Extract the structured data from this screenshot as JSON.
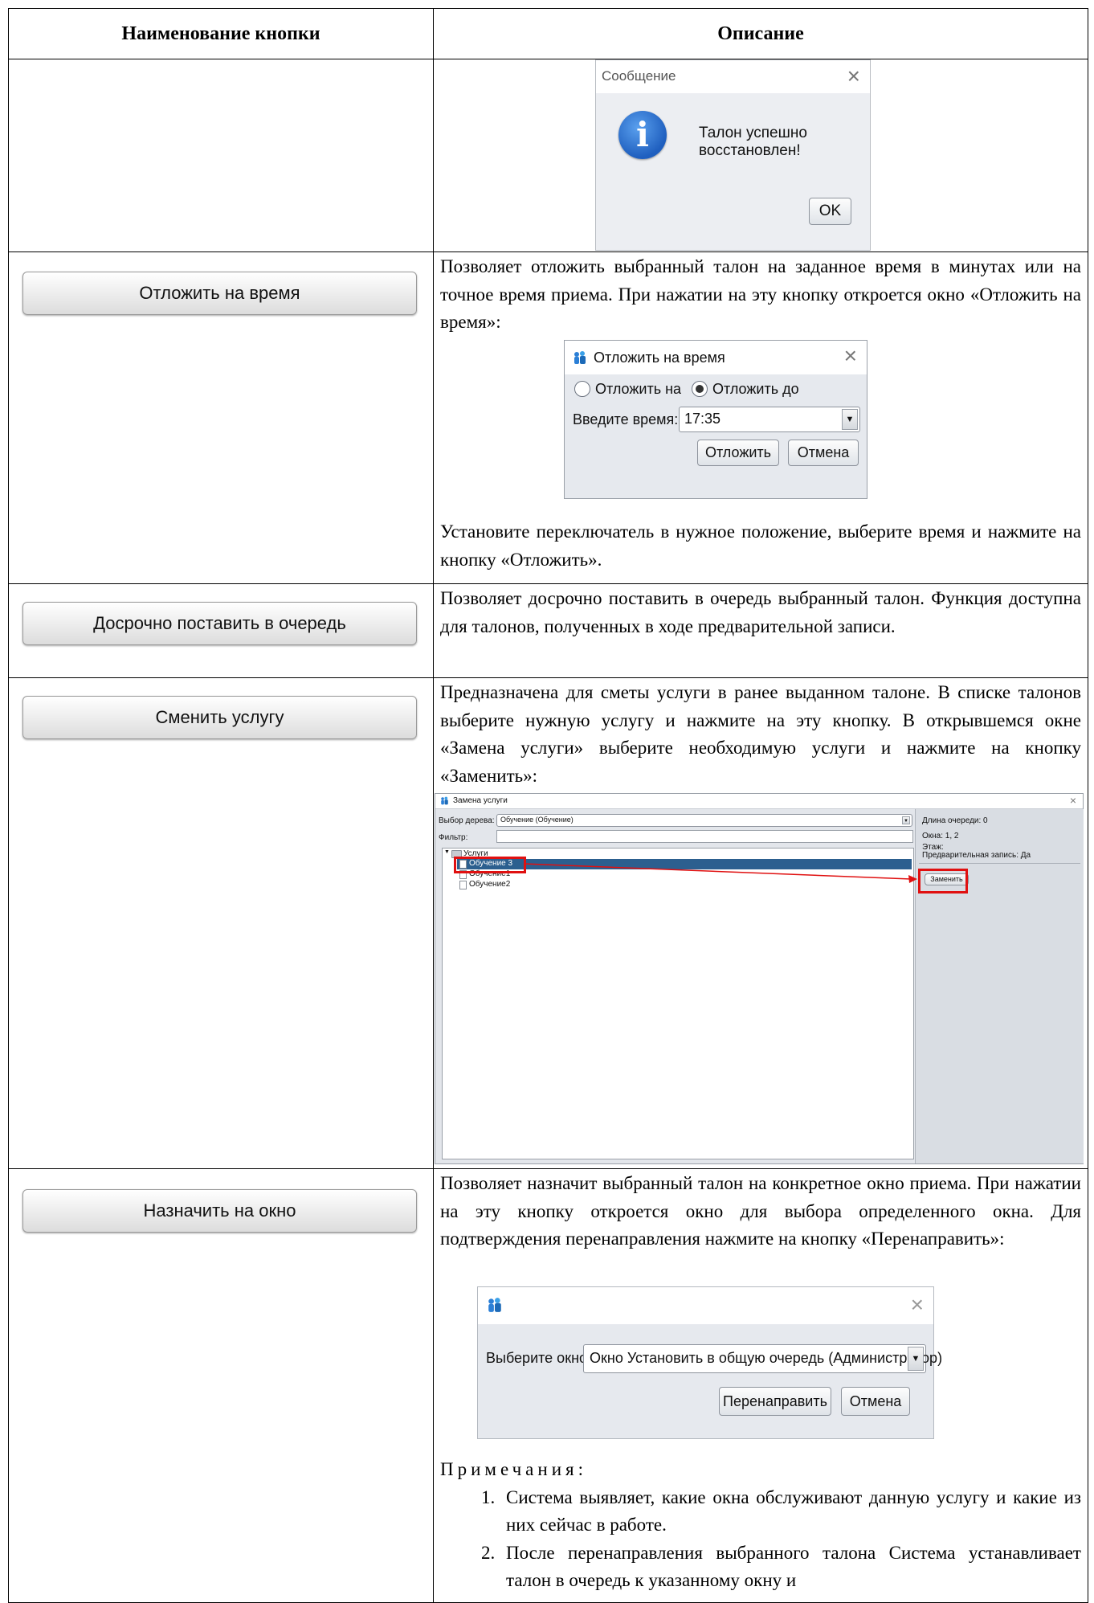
{
  "table": {
    "header": {
      "col1": "Наименование кнопки",
      "col2": "Описание"
    }
  },
  "msg_dialog": {
    "title": "Сообщение",
    "text": "Талон успешно восстановлен!",
    "ok": "OK",
    "close": "×",
    "info_glyph": "i",
    "icon": "info-icon"
  },
  "otl": {
    "button": "Отложить на время",
    "desc1": "Позволяет отложить выбранный талон на заданное время в минутах или на точное время приема. При нажатии на эту кнопку откроется окно «Отложить на время»:",
    "dialog": {
      "title": "Отложить на время",
      "close": "×",
      "radio1": "Отложить на",
      "radio2": "Отложить до",
      "time_label": "Введите время:",
      "time_value": "17:35",
      "btn_ok": "Отложить",
      "btn_cancel": "Отмена"
    },
    "desc2": "Установите переключатель в нужное положение, выберите время и нажмите на кнопку «Отложить»."
  },
  "dos": {
    "button": "Досрочно поставить в очередь",
    "desc": "Позволяет досрочно поставить в очередь выбранный талон. Функция доступна для талонов, полученных в ходе предварительной записи."
  },
  "sm": {
    "button": "Сменить услугу",
    "desc": "Предназначена для сметы услуги в ранее выданном талоне. В списке талонов выберите нужную услугу и нажмите на эту кнопку. В открывшемся окне «Замена услуги» выберите необходимую услуги и нажмите на кнопку «Заменить»:",
    "dialog": {
      "title": "Замена услуги",
      "close": "×",
      "tree_label": "Выбор дерева:",
      "tree_value": "Обучение (Обучение)",
      "filter_label": "Фильтр:",
      "root": "Услуги",
      "items": [
        "Обучение 3",
        "Обучение1",
        "Обучение2"
      ],
      "info": {
        "queue": "Длина очереди:  0",
        "windows": "Окна:  1, 2",
        "floor": "Этаж:",
        "prereg": "Предварительная запись:  Да"
      },
      "replace": "Заменить"
    },
    "annotation_color": "#e01010"
  },
  "naz": {
    "button": "Назначить на окно",
    "desc": "Позволяет назначит выбранный талон на конкретное окно приема. При нажатии на эту кнопку откроется окно для выбора определенного окна. Для подтверждения перенаправления нажмите на кнопку «Перенаправить»:",
    "dialog": {
      "close": "×",
      "label": "Выберите окно:",
      "value": "Окно Установить в общую очередь (Администратор)",
      "btn_ok": "Перенаправить",
      "btn_cancel": "Отмена"
    },
    "notes_title": "Примечания:",
    "notes": [
      "Система выявляет, какие окна обслуживают данную услугу и какие из них сейчас в работе.",
      "После перенаправления выбранного талона Система устанавливает талон в очередь к указанному окну и"
    ]
  }
}
